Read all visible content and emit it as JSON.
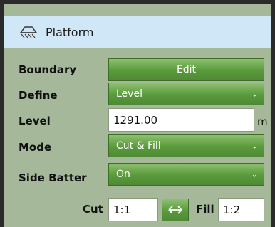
{
  "panel": {
    "title": "Platform",
    "header_icon": "platform-icon"
  },
  "boundary": {
    "label": "Boundary",
    "button": "Edit"
  },
  "define": {
    "label": "Define",
    "value": "Level"
  },
  "level": {
    "label": "Level",
    "value": "1291.00",
    "unit": "m"
  },
  "mode": {
    "label": "Mode",
    "value": "Cut & Fill"
  },
  "side_batter": {
    "label": "Side Batter",
    "value": "On"
  },
  "slopes": {
    "cut_label": "Cut",
    "cut_value": "1:1",
    "fill_label": "Fill",
    "fill_value": "1:2",
    "swap_icon": "swap-arrows-icon"
  },
  "colors": {
    "header_bg": "#cfe7f6",
    "panel_bg": "#a5b89a",
    "button_green": "#5a9a3c"
  }
}
